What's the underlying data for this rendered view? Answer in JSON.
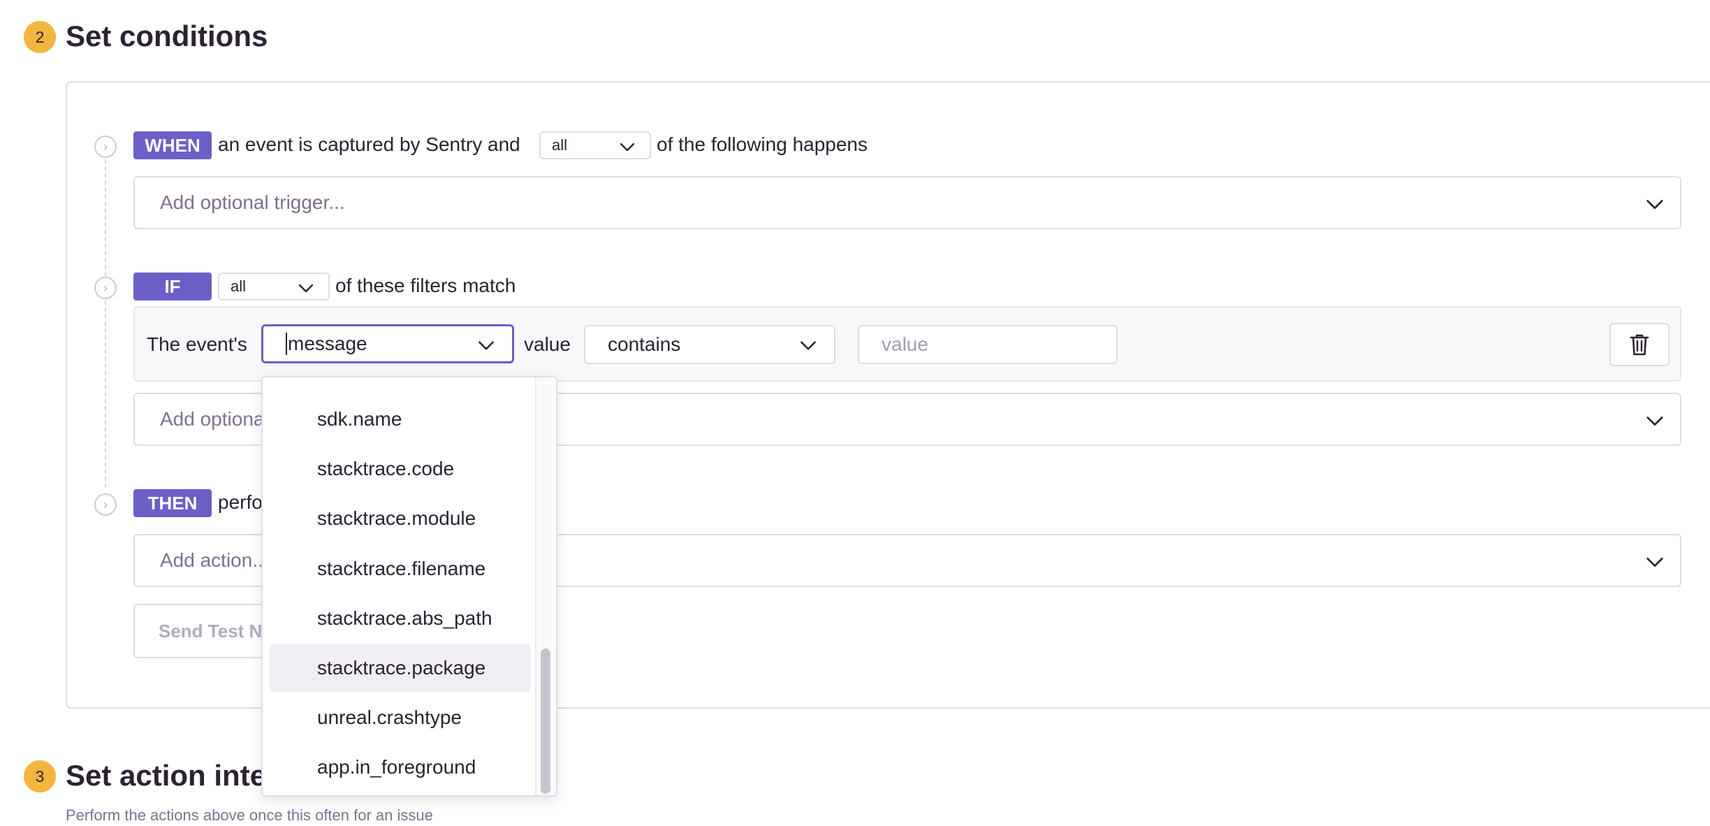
{
  "step2": {
    "number": "2",
    "title": "Set conditions"
  },
  "when": {
    "tag": "WHEN",
    "text_before": "an event is captured by Sentry and",
    "match_value": "all",
    "text_after": "of the following happens",
    "trigger_placeholder": "Add optional trigger..."
  },
  "if": {
    "tag": "IF",
    "match_value": "all",
    "text_after": "of these filters match",
    "filter": {
      "prefix": "The event's",
      "attribute": "message",
      "value_label": "value",
      "operator": "contains",
      "value_placeholder": "value"
    },
    "add_filter_placeholder": "Add optional filter..."
  },
  "then": {
    "tag": "THEN",
    "text_after": "perform these actions",
    "action_placeholder": "Add action...",
    "test_button": "Send Test Notification"
  },
  "dropdown": {
    "options": [
      "sdk.name",
      "stacktrace.code",
      "stacktrace.module",
      "stacktrace.filename",
      "stacktrace.abs_path",
      "stacktrace.package",
      "unreal.crashtype",
      "app.in_foreground"
    ],
    "hovered": "stacktrace.package"
  },
  "step3": {
    "number": "3",
    "title": "Set action interval",
    "subtitle": "Perform the actions above once this often for an issue"
  },
  "colors": {
    "accent": "#6c5fc7",
    "badge": "#f2b63f",
    "border": "#e0dce5",
    "text": "#2b2233",
    "muted": "#80708f"
  }
}
